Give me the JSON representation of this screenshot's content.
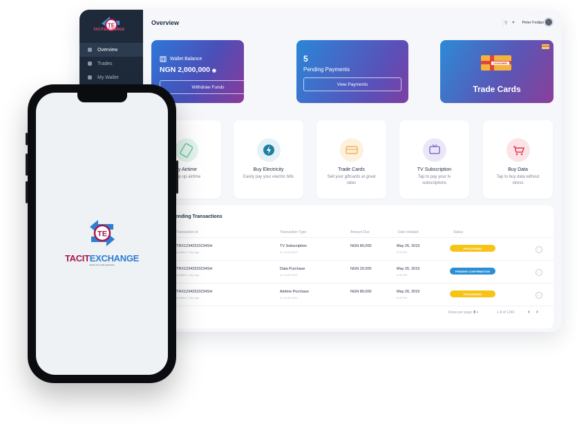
{
  "app": {
    "brand_tacit": "TACIT",
    "brand_exchange": "EXCHANGE",
    "logo_text": "TE",
    "tagline": "hassle free trade guarantee"
  },
  "sidebar": {
    "items": [
      {
        "label": "Overview",
        "icon": "pie-chart-icon",
        "active": true
      },
      {
        "label": "Trades",
        "icon": "card-icon"
      },
      {
        "label": "My Wallet",
        "icon": "wallet-icon"
      }
    ]
  },
  "header": {
    "title": "Overview",
    "user_name": "Peter Fodipo"
  },
  "cards": {
    "wallet": {
      "title": "Wallet Balance",
      "balance": "NGN 2,000,000",
      "button": "Withdraw Funds"
    },
    "pending": {
      "count": "5",
      "label": "Pending Payments",
      "button": "View Payments"
    },
    "trade": {
      "title": "Trade Cards",
      "voucher": "VOUCHER"
    }
  },
  "services": {
    "title": "vices",
    "items": [
      {
        "title": "uy Airtime",
        "subtitle": "p top up airtime",
        "icon": "phone-icon",
        "color": "#6ec7a5"
      },
      {
        "title": "Buy Electricity",
        "subtitle": "Easily pay your electric bills",
        "icon": "lightning-icon",
        "color": "#1f7fa1"
      },
      {
        "title": "Trade Cards",
        "subtitle": "Sell your giftcards at great rates",
        "icon": "giftcard-icon",
        "color": "#f3a43a"
      },
      {
        "title": "TV Subscription",
        "subtitle": "Tap to pay your tv subscriptions",
        "icon": "tv-icon",
        "color": "#6d5bc6"
      },
      {
        "title": "Buy Data",
        "subtitle": "Tap to buy data without stress",
        "icon": "cart-icon",
        "color": "#e8344d"
      }
    ]
  },
  "transactions": {
    "title": "Pending Transactions",
    "columns": [
      "Transaction id",
      "Transaction Type",
      "Amount Due",
      "Date Initiated",
      "Status"
    ],
    "rows": [
      {
        "id": "TRX12342323234SH",
        "sub": "updated 1 day ago",
        "type": "TV Subscription",
        "type_sub": "on 24.05.2019",
        "amount": "NGN 80,000",
        "date": "May 26, 2019",
        "time": "6:30 PM",
        "status": "PROCESSING",
        "status_color": "#f7c315"
      },
      {
        "id": "TRX12342323234SH",
        "sub": "updated 1 day ago",
        "type": "Data Purchase",
        "type_sub": "on 24.05.2019",
        "amount": "NGN 20,000",
        "date": "May 26, 2019",
        "time": "6:30 PM",
        "status": "PENDING CONFIRMATION",
        "status_color": "#2b8fd6"
      },
      {
        "id": "TRX12342323234SH",
        "sub": "updated 1 day ago",
        "type": "Airtime Purchase",
        "type_sub": "on 24.05.2019",
        "amount": "NGN 80,000",
        "date": "May 26, 2019",
        "time": "6:30 PM",
        "status": "PROCESSING",
        "status_color": "#f7c315"
      }
    ],
    "rows_per_page_label": "Rows per page:",
    "rows_per_page_value": "8",
    "range": "1-8 of 1240"
  }
}
